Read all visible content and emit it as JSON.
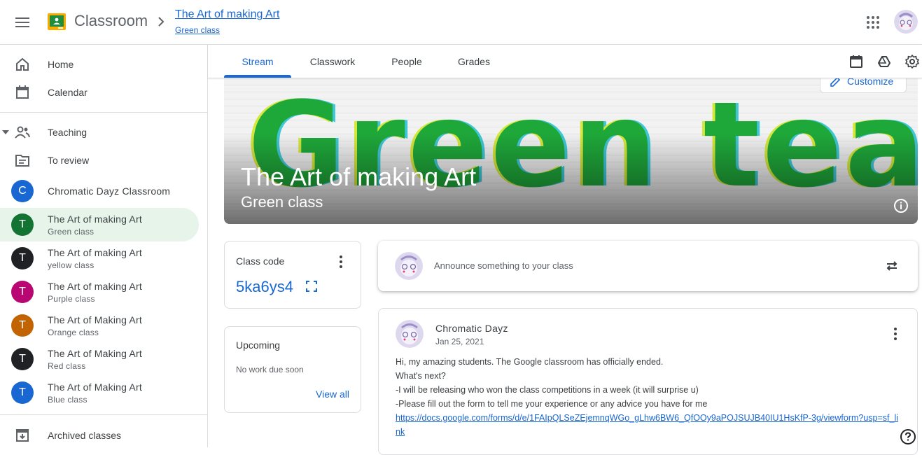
{
  "header": {
    "brand": "Classroom",
    "class_title": "The Art of making Art",
    "class_section": "Green class"
  },
  "sidebar": {
    "home": "Home",
    "calendar": "Calendar",
    "teaching": "Teaching",
    "to_review": "To review",
    "archived": "Archived classes",
    "classes": [
      {
        "initial": "C",
        "name": "Chromatic Dayz Classroom",
        "section": "",
        "color": "#1967d2"
      },
      {
        "initial": "T",
        "name": "The Art of making Art",
        "section": "Green class",
        "color": "#137333"
      },
      {
        "initial": "T",
        "name": "The Art of making Art",
        "section": "yellow class",
        "color": "#202124"
      },
      {
        "initial": "T",
        "name": "The Art of making Art",
        "section": "Purple class",
        "color": "#b80672"
      },
      {
        "initial": "T",
        "name": "The Art of Making Art",
        "section": "Orange class",
        "color": "#c26401"
      },
      {
        "initial": "T",
        "name": "The Art of Making Art",
        "section": "Red class",
        "color": "#202124"
      },
      {
        "initial": "T",
        "name": "The Art of Making Art",
        "section": "Blue class",
        "color": "#1967d2"
      }
    ]
  },
  "tabs": [
    "Stream",
    "Classwork",
    "People",
    "Grades"
  ],
  "banner": {
    "image_text": "Green team",
    "title": "The Art of making Art",
    "subtitle": "Green class",
    "customize": "Customize"
  },
  "class_code": {
    "label": "Class code",
    "value": "5ka6ys4"
  },
  "upcoming": {
    "label": "Upcoming",
    "empty": "No work due soon",
    "link": "View all"
  },
  "announce": {
    "placeholder": "Announce something to your class"
  },
  "post": {
    "author": "Chromatic Dayz",
    "date": "Jan 25, 2021",
    "lines": [
      "Hi, my amazing students. The Google classroom has officially ended.",
      "What's next?",
      "-I will be releasing who won the class competitions in a week (it will surprise u)",
      "-Please fill out the form to tell me your experience or any advice you have for me"
    ],
    "link": "https://docs.google.com/forms/d/e/1FAIpQLSeZEjemnqWGo_gLhw6BW6_QfOOy9aPOJSUJB40IU1HsKfP-3g/viewform?usp=sf_link"
  },
  "colors": {
    "accent": "#1967d2",
    "active_bg": "#e6f4ea",
    "banner_green": "#1fa83a"
  }
}
